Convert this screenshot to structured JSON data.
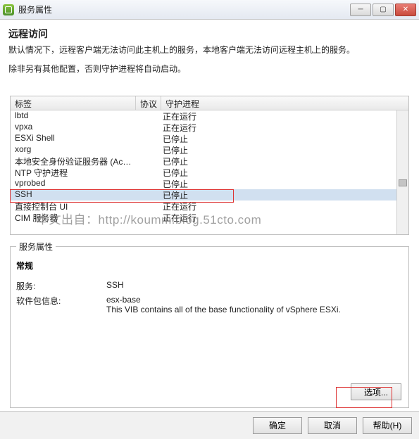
{
  "window": {
    "title": "服务属性"
  },
  "header": {
    "title": "远程访问",
    "desc1": "默认情况下，远程客户端无法访问此主机上的服务，本地客户端无法访问远程主机上的服务。",
    "desc2": "除非另有其他配置，否则守护进程将自动启动。"
  },
  "table": {
    "cols": {
      "label": "标签",
      "protocol": "协议",
      "daemon": "守护进程"
    },
    "rows": [
      {
        "label": "lbtd",
        "daemon": "正在运行",
        "sel": false
      },
      {
        "label": "vpxa",
        "daemon": "正在运行",
        "sel": false
      },
      {
        "label": "ESXi Shell",
        "daemon": "已停止",
        "sel": false
      },
      {
        "label": "xorg",
        "daemon": "已停止",
        "sel": false
      },
      {
        "label": "本地安全身份验证服务器 (Active...",
        "daemon": "已停止",
        "sel": false
      },
      {
        "label": "NTP 守护进程",
        "daemon": "已停止",
        "sel": false
      },
      {
        "label": "vprobed",
        "daemon": "已停止",
        "sel": false
      },
      {
        "label": "SSH",
        "daemon": "已停止",
        "sel": true
      },
      {
        "label": "直接控制台 UI",
        "daemon": "正在运行",
        "sel": false
      },
      {
        "label": "CIM 服务器",
        "daemon": "正在运行",
        "sel": false
      }
    ]
  },
  "props": {
    "legend": "服务属性",
    "group": "常规",
    "service_k": "服务:",
    "service_v": "SSH",
    "pkg_k": "软件包信息:",
    "pkg_name": "esx-base",
    "pkg_desc": "This VIB contains all of the base functionality of vSphere ESXi."
  },
  "buttons": {
    "options": "选项...",
    "ok": "确定",
    "cancel": "取消",
    "help": "帮助(H)"
  },
  "watermark": "本文出自：http://koumm.blog.51cto.com"
}
